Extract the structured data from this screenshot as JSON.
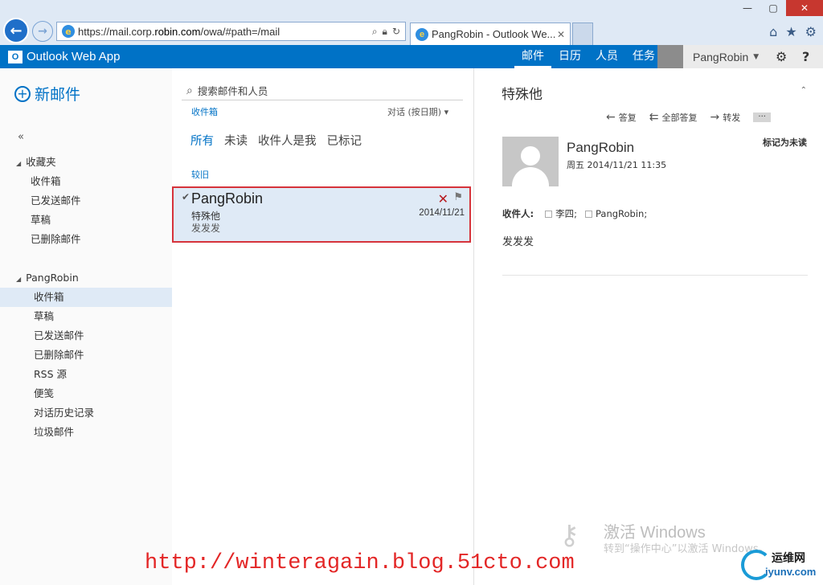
{
  "browser": {
    "url_prefix": "https://mail.corp.",
    "url_host": "robin.com",
    "url_suffix": "/owa/#path=/mail",
    "tab_title": "PangRobin - Outlook We...",
    "win_min": "—",
    "win_max": "▢",
    "win_close": "✕"
  },
  "owa": {
    "app_name": "Outlook Web App",
    "nav": [
      "邮件",
      "日历",
      "人员",
      "任务"
    ],
    "user_name": "PangRobin"
  },
  "left": {
    "new_mail": "新邮件",
    "collapse": "«",
    "favorites_label": "收藏夹",
    "favorites": [
      "收件箱",
      "已发送邮件",
      "草稿",
      "已删除邮件"
    ],
    "account_label": "PangRobin",
    "account_folders": [
      "收件箱",
      "草稿",
      "已发送邮件",
      "已删除邮件",
      "RSS 源",
      "便笺",
      "对话历史记录",
      "垃圾邮件"
    ]
  },
  "middle": {
    "search_placeholder": "搜索邮件和人员",
    "folder_name": "收件箱",
    "conversation_sort": "对话 (按日期)",
    "filters": [
      "所有",
      "未读",
      "收件人是我",
      "已标记"
    ],
    "group": "较旧",
    "mail": {
      "sender": "PangRobin",
      "subject": "特殊他",
      "preview": "发发发",
      "date": "2014/11/21"
    }
  },
  "reading": {
    "subject": "特殊他",
    "reply": "答复",
    "reply_all": "全部答复",
    "forward": "转发",
    "more": "···",
    "from": "PangRobin",
    "sent": "周五 2014/11/21 11:35",
    "mark_unread": "标记为未读",
    "to_label": "收件人:",
    "recipients": [
      "李四;",
      "PangRobin;"
    ],
    "body": "发发发"
  },
  "watermarks": {
    "activate_title": "激活 Windows",
    "activate_sub": "转到“操作中心”以激活 Windows。",
    "blog_url": "http://winteragain.blog.51cto.com",
    "site_top": "运维网",
    "site_bottom": "iyunv.com"
  },
  "colors": {
    "owa_blue": "#0072c6",
    "selection": "#dfeaf6",
    "highlight_border": "#d6333b"
  }
}
